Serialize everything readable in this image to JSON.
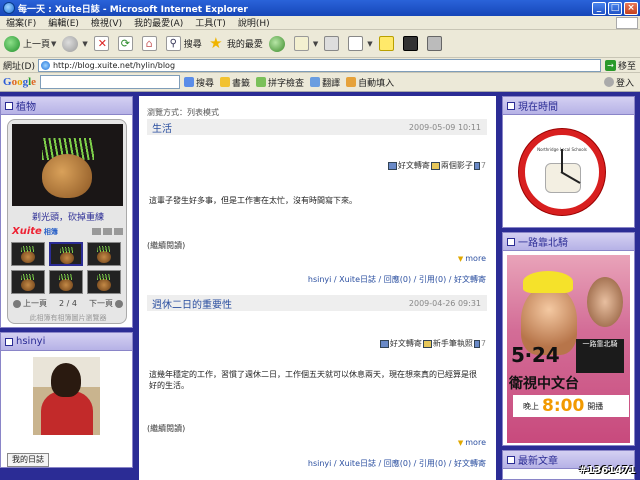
{
  "window": {
    "title": "每一天 : Xuite日誌 - Microsoft Internet Explorer"
  },
  "menu": [
    "檔案(F)",
    "編輯(E)",
    "檢視(V)",
    "我的最愛(A)",
    "工具(T)",
    "說明(H)"
  ],
  "toolbar": {
    "back": "上一頁",
    "search": "搜尋",
    "favorites": "我的最愛"
  },
  "address": {
    "label": "網址(D)",
    "url": "http://blog.xuite.net/hylin/blog",
    "go": "移至"
  },
  "google": {
    "logo_letters": [
      "G",
      "o",
      "o",
      "g",
      "l",
      "e"
    ],
    "items": [
      "搜尋",
      "書籤",
      "拼字檢查",
      "翻譯",
      "自動填入",
      "登入"
    ]
  },
  "left": {
    "plant": {
      "title": "植物",
      "caption": "剃光頭，砍掉重練",
      "brand": "Xuite",
      "brand_sub": "相簿",
      "prev": "上一頁",
      "page": "2 / 4",
      "next": "下一頁",
      "footer": "此相簿有相簿圖片瀏覽器"
    },
    "profile": {
      "title": "hsinyi",
      "diary_button": "我的日誌"
    }
  },
  "main": {
    "sort": "瀏覽方式：列表模式",
    "posts": [
      {
        "title": "生活",
        "date": "2009-05-09 10:11",
        "share": "好文轉寄",
        "share2": "兩個影子",
        "body": "這輩子發生好多事，但是工作害在太忙，沒有時間寫下來。",
        "readmore": "(繼續閱讀)",
        "more": "more",
        "meta": "hsinyi / Xuite日誌 / 回應(0) / 引用(0) / 好文轉寄"
      },
      {
        "title": "週休二日的重要性",
        "date": "2009-04-26 09:31",
        "share": "好文轉寄",
        "share2": "新手筆執照",
        "body": "這幾年穩定的工作，習慣了週休二日，工作個五天就可以休息兩天，現在想來真的已經算是很好的生活。",
        "readmore": "(繼續閱讀)",
        "more": "more",
        "meta": "hsinyi / Xuite日誌 / 回應(0) / 引用(0) / 好文轉寄"
      }
    ]
  },
  "right": {
    "clock": {
      "title": "現在時間",
      "school": "Northridge Local Schools"
    },
    "ad": {
      "title": "一路靠北騎",
      "date": "5‧24",
      "channel": "衛視中文台",
      "time_prefix": "晚上",
      "time": "8:00",
      "time_suffix": "開播",
      "badge": "一路靠北騎"
    },
    "latest": {
      "title": "最新文章"
    }
  },
  "watermark": "#1361471",
  "colors": {
    "page_bg": "#2b2c95",
    "title_bar": "#1646b8",
    "link": "#2b4fa0"
  }
}
